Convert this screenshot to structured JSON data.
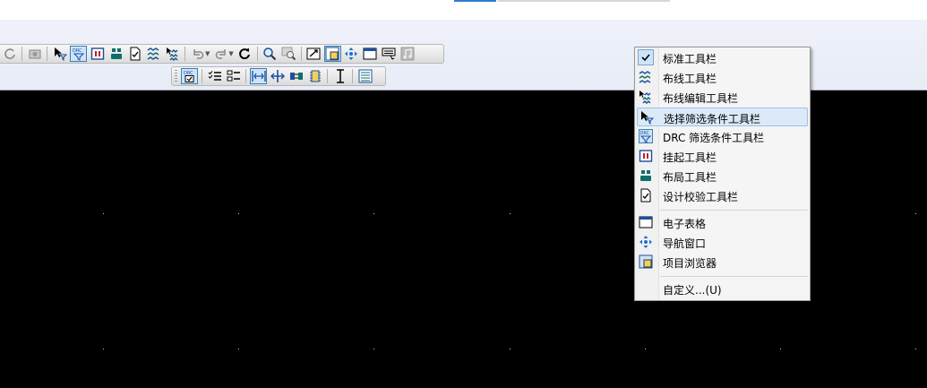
{
  "toolbar_icons": {
    "standard": [
      "refresh-icon",
      "camera-icon",
      "select-filter-icon",
      "drc-filter-icon",
      "pause-icon",
      "layout-icon",
      "design-check-icon",
      "routing-icon",
      "routing-edit-icon",
      "undo-icon",
      "redo-icon",
      "rotate-icon",
      "zoom-icon",
      "zoom-area-icon",
      "window-icon",
      "project-browser-icon",
      "navigation-icon",
      "spreadsheet-icon",
      "keyboard-icon",
      "music-icon"
    ],
    "alignment": [
      "drc-check-icon",
      "list-check-icon",
      "list-icon",
      "distribute-horizontal-icon",
      "move-cross-icon",
      "swap-icon",
      "chip-icon",
      "vertical-space-icon",
      "properties-icon"
    ]
  },
  "context_menu": {
    "items": [
      {
        "label": "标准工具栏",
        "icon": "checkmark-icon",
        "checked": true
      },
      {
        "label": "布线工具栏",
        "icon": "routing-icon"
      },
      {
        "label": "布线编辑工具栏",
        "icon": "routing-edit-icon"
      },
      {
        "label": "选择筛选条件工具栏",
        "icon": "select-filter-icon",
        "highlighted": true
      },
      {
        "label": "DRC 筛选条件工具栏",
        "icon": "drc-filter-icon"
      },
      {
        "label": "挂起工具栏",
        "icon": "pause-icon"
      },
      {
        "label": "布局工具栏",
        "icon": "layout-icon"
      },
      {
        "label": "设计校验工具栏",
        "icon": "design-check-icon"
      },
      {
        "label": "电子表格",
        "icon": "spreadsheet-icon"
      },
      {
        "label": "导航窗口",
        "icon": "navigation-icon"
      },
      {
        "label": "项目浏览器",
        "icon": "project-browser-icon"
      },
      {
        "label": "自定义...(U)",
        "icon": ""
      }
    ]
  },
  "colors": {
    "menu_highlight": "#dbe9f8",
    "canvas": "#000000",
    "toolbar_bg": "#eff2fa",
    "icon_blue": "#1b4fa0",
    "icon_red": "#c41e1e",
    "icon_teal": "#0e6f6a"
  }
}
